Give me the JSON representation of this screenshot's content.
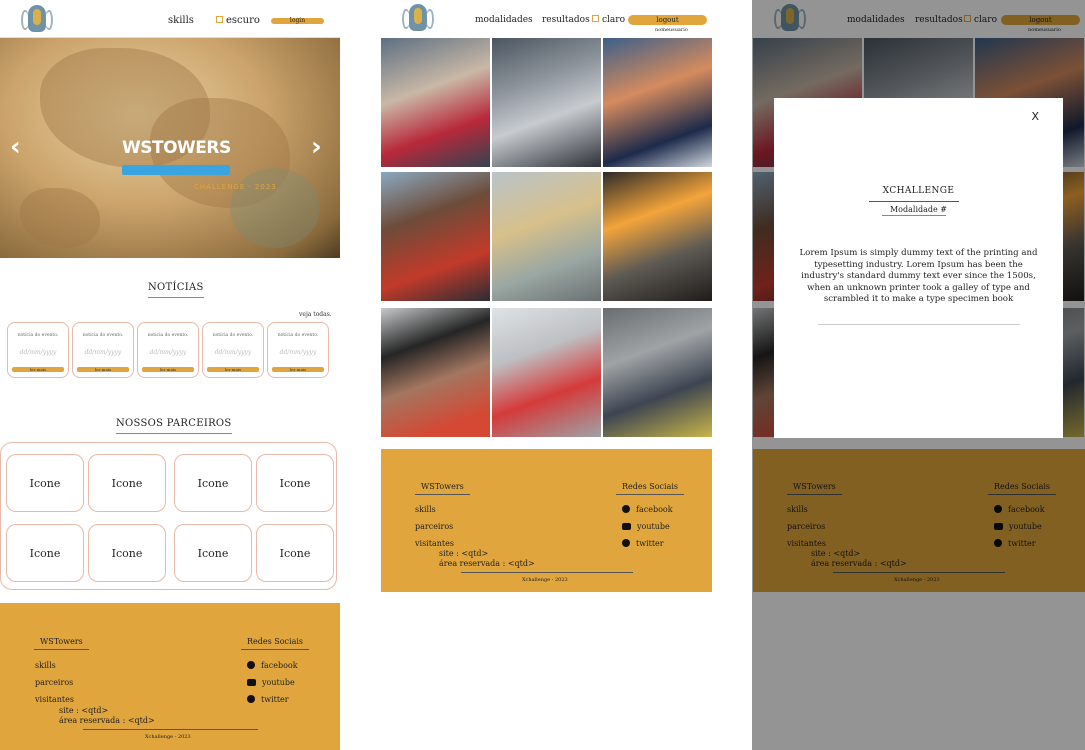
{
  "colors": {
    "accent": "#e0a53c",
    "accent_dark": "#8c6b2b",
    "card_border": "#e8b9a8",
    "carousel_bar": "#3aa4e0"
  },
  "panel1": {
    "nav": {
      "skills": "skills",
      "theme": "escuro",
      "login": "login"
    },
    "carousel": {
      "title": "WSTOWERS",
      "subtitle": "CHALLENGE · 2023",
      "prev_icon": "chevron-left-icon",
      "next_icon": "chevron-right-icon"
    },
    "news": {
      "title": "NOTÍCIAS",
      "see_all": "veja todas.",
      "cards": [
        {
          "title": "notícia do evento.",
          "date": "dd/mm/yyyy",
          "button": "ler mais"
        },
        {
          "title": "notícia do evento.",
          "date": "dd/mm/yyyy",
          "button": "ler mais"
        },
        {
          "title": "notícia do evento.",
          "date": "dd/mm/yyyy",
          "button": "ler mais"
        },
        {
          "title": "notícia do evento.",
          "date": "dd/mm/yyyy",
          "button": "ler mais"
        },
        {
          "title": "notícia do evento.",
          "date": "dd/mm/yyyy",
          "button": "ler mais"
        }
      ]
    },
    "partners": {
      "title": "NOSSOS PARCEIROS",
      "items": [
        "Icone",
        "Icone",
        "Icone",
        "Icone",
        "Icone",
        "Icone",
        "Icone",
        "Icone"
      ]
    }
  },
  "panel2": {
    "nav": {
      "modalidades": "modalidades",
      "resultados": "resultados",
      "theme": "claro",
      "logout": "logout",
      "username": "nomeusuario"
    },
    "photos": [
      "photo-1",
      "photo-2",
      "photo-3",
      "photo-4",
      "photo-5",
      "photo-6",
      "photo-7",
      "photo-8",
      "photo-9"
    ]
  },
  "panel3": {
    "nav": {
      "modalidades": "modalidades",
      "resultados": "resultados",
      "theme": "claro",
      "logout": "logout",
      "username": "nomeusuario"
    },
    "modal": {
      "close": "X",
      "title": "XCHALLENGE",
      "subtitle": "Modalidade #",
      "body": "Lorem Ipsum is simply dummy text of the printing and typesetting industry. Lorem Ipsum has been the industry's standard dummy text ever since the 1500s, when an unknown printer took a galley of type and scrambled it to make a type specimen book"
    }
  },
  "footer": {
    "brand": "WSTowers",
    "brand_panel2": "WSTowers",
    "links": {
      "skills": "skills",
      "parceiros": "parceiros",
      "visitantes": "visitantes"
    },
    "visitors": {
      "site": "site : <qtd>",
      "reserved": "área reservada : <qtd>"
    },
    "social_title": "Redes Sociais",
    "social": [
      {
        "label": "facebook",
        "icon": "facebook-icon"
      },
      {
        "label": "youtube",
        "icon": "youtube-icon"
      },
      {
        "label": "twitter",
        "icon": "twitter-icon"
      }
    ],
    "copyright": "Xchallenge - 2023",
    "copyright_panel2": "Xchallenge - 2023"
  }
}
